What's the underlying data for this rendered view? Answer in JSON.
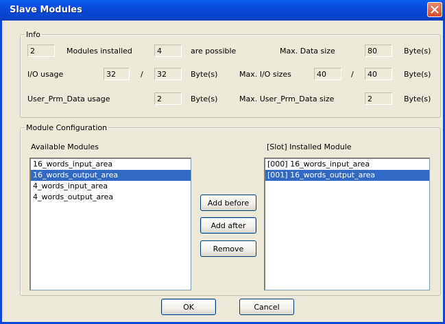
{
  "window": {
    "title": "Slave Modules",
    "close_icon": "close-icon"
  },
  "info": {
    "legend": "Info",
    "modules_installed_value": "2",
    "modules_installed_label": "Modules installed",
    "possible_value": "4",
    "possible_label": "are possible",
    "max_data_size_label": "Max. Data size",
    "max_data_size_value": "80",
    "max_data_size_unit": "Byte(s)",
    "io_usage_label": "I/O usage",
    "io_usage_in": "32",
    "io_usage_sep": "/",
    "io_usage_out": "32",
    "io_usage_unit": "Byte(s)",
    "max_io_label": "Max. I/O sizes",
    "max_io_in": "40",
    "max_io_sep": "/",
    "max_io_out": "40",
    "max_io_unit": "Byte(s)",
    "prm_usage_label": "User_Prm_Data usage",
    "prm_usage_value": "2",
    "prm_usage_unit": "Byte(s)",
    "max_prm_label": "Max. User_Prm_Data size",
    "max_prm_value": "2",
    "max_prm_unit": "Byte(s)"
  },
  "config": {
    "legend": "Module Configuration",
    "available_label": "Available Modules",
    "installed_label": "[Slot] Installed Module",
    "available": [
      "16_words_input_area",
      "16_words_output_area",
      "4_words_input_area",
      "4_words_output_area"
    ],
    "available_selected_index": 1,
    "installed": [
      "[000] 16_words_input_area",
      "[001] 16_words_output_area"
    ],
    "installed_selected_index": 1,
    "add_before": "Add before",
    "add_after": "Add after",
    "remove": "Remove"
  },
  "footer": {
    "ok": "OK",
    "cancel": "Cancel"
  },
  "colors": {
    "title_bar": "#0a4ad8",
    "selection": "#316ac5",
    "dialog_bg": "#ece9d8",
    "close_button": "#d84a2a"
  }
}
